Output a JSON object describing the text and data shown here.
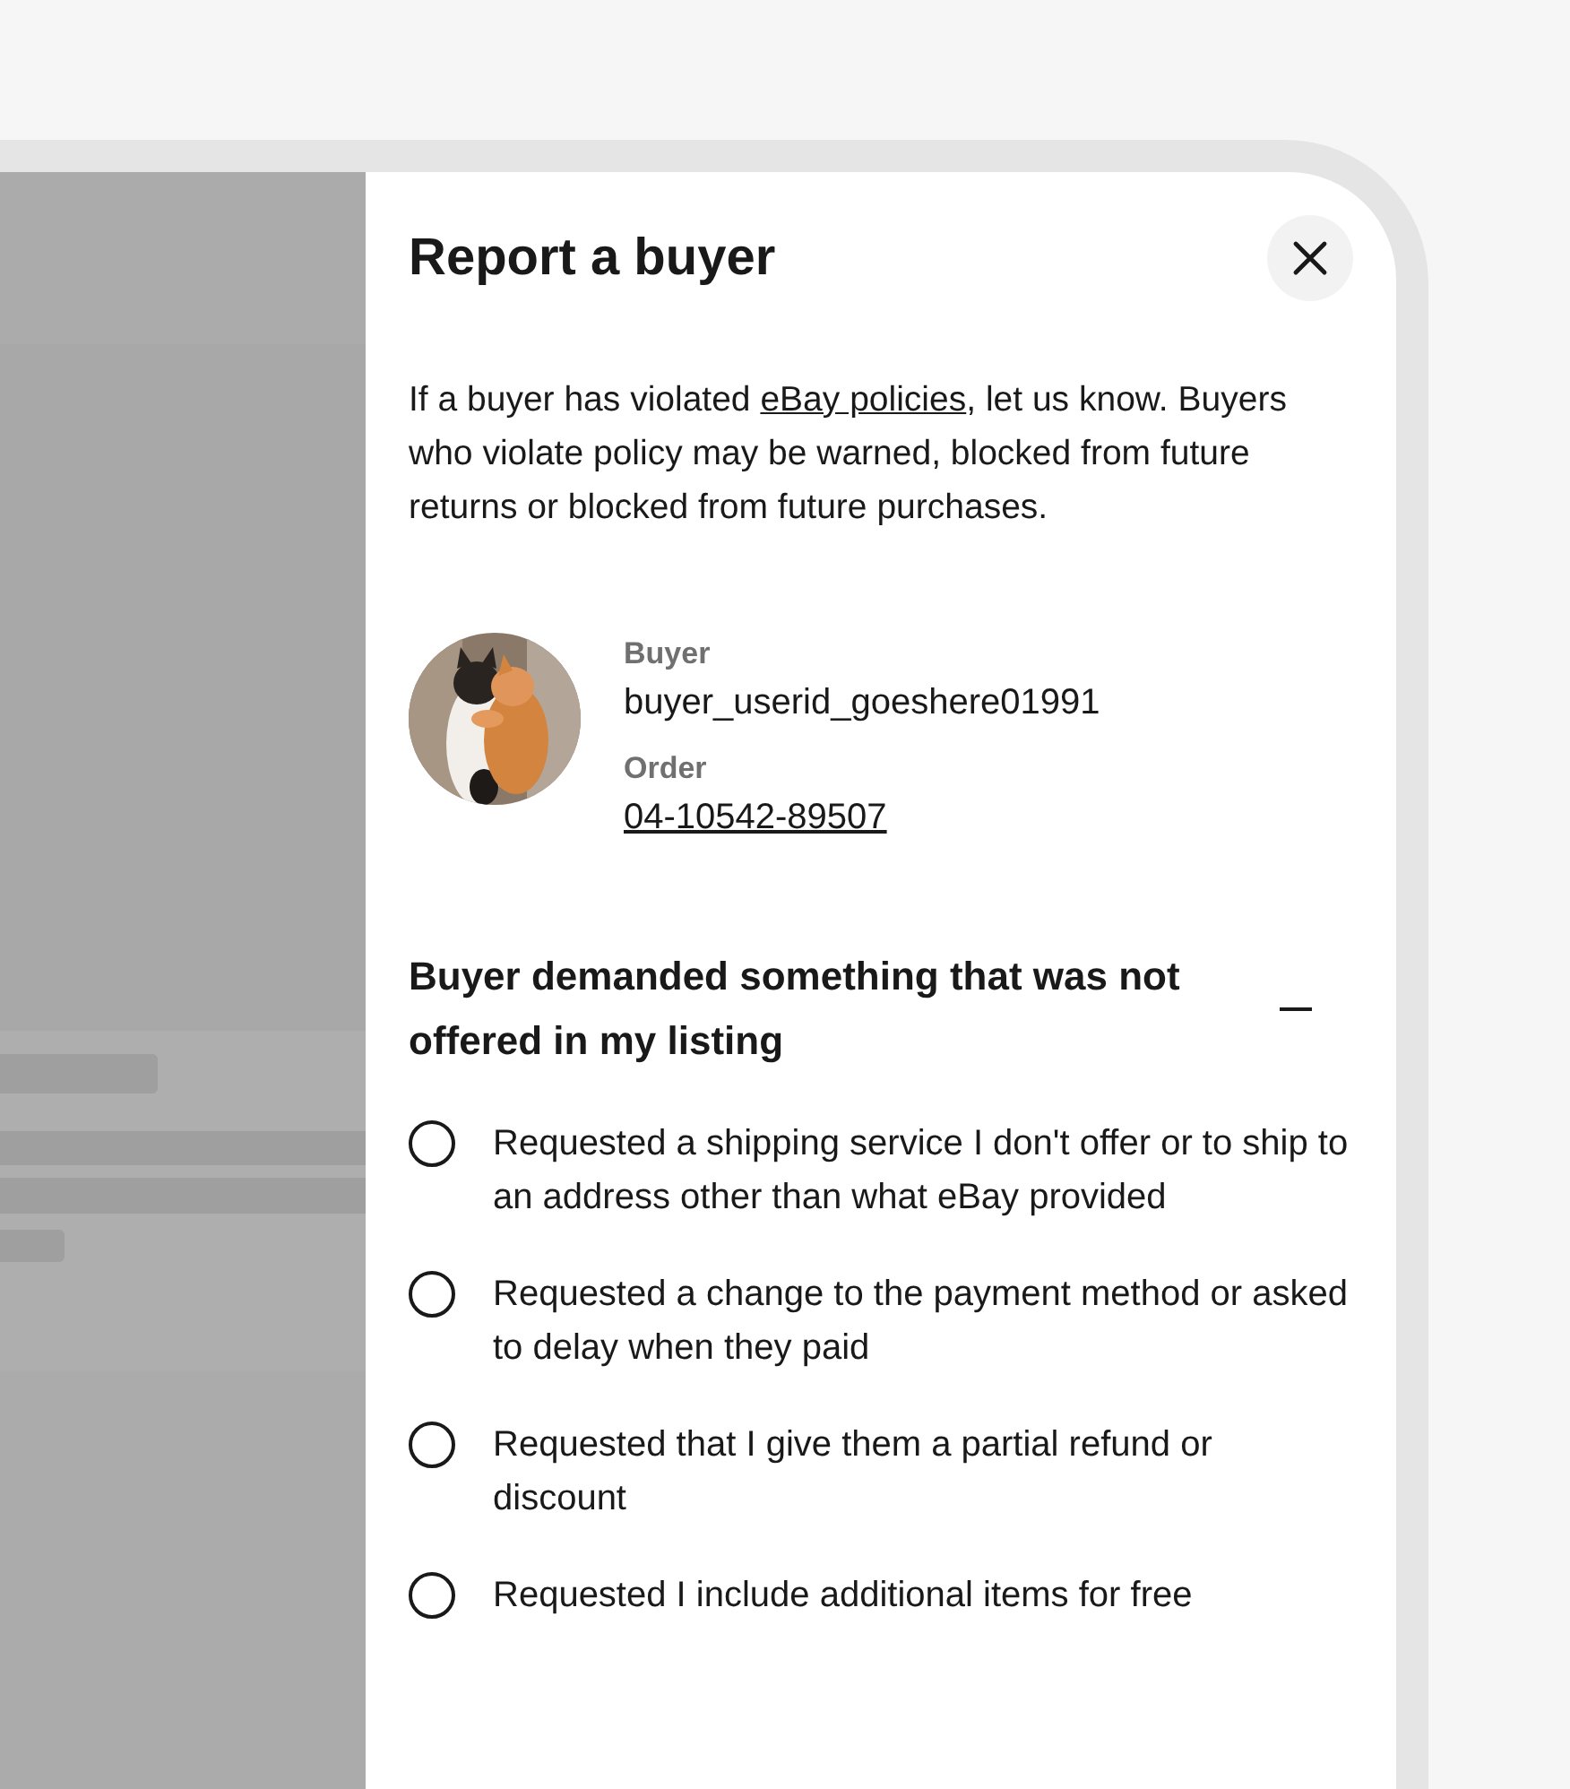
{
  "dialog": {
    "title": "Report a buyer",
    "intro": {
      "before": "If a buyer has violated ",
      "link": "eBay policies",
      "after": ", let us know. Buyers who violate policy may be warned, blocked from future returns or blocked from future purchases."
    },
    "buyer": {
      "buyer_label": "Buyer",
      "user_id": "buyer_userid_goeshere01991",
      "order_label": "Order",
      "order_number": "04-10542-89507"
    },
    "section": {
      "heading": "Buyer demanded something that was not offered in my listing",
      "expanded": true,
      "options": [
        {
          "label": "Requested a shipping service I don't offer or to ship to an address other than what eBay provided",
          "selected": false
        },
        {
          "label": "Requested a change to the payment method or asked to delay when they paid",
          "selected": false
        },
        {
          "label": "Requested that I give them a partial refund or discount",
          "selected": false
        },
        {
          "label": "Requested I include additional items for free",
          "selected": false
        }
      ]
    }
  }
}
